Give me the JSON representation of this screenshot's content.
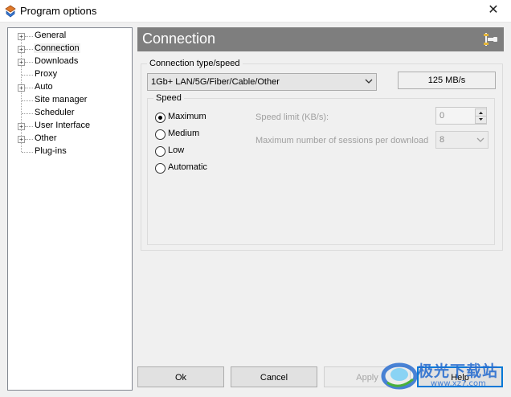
{
  "window": {
    "title": "Program options",
    "close_glyph": "✕"
  },
  "tree": {
    "items": [
      {
        "label": "General",
        "expandable": true
      },
      {
        "label": "Connection",
        "expandable": true,
        "selected": true
      },
      {
        "label": "Downloads",
        "expandable": true
      },
      {
        "label": "Proxy",
        "expandable": false
      },
      {
        "label": "Auto",
        "expandable": true
      },
      {
        "label": "Site manager",
        "expandable": false
      },
      {
        "label": "Scheduler",
        "expandable": false
      },
      {
        "label": "User Interface",
        "expandable": true
      },
      {
        "label": "Other",
        "expandable": true
      },
      {
        "label": "Plug-ins",
        "expandable": false
      }
    ],
    "expand_glyph": "+"
  },
  "header": {
    "title": "Connection",
    "icon": "plug-icon"
  },
  "connection": {
    "group_label": "Connection type/speed",
    "type_value": "1Gb+  LAN/5G/Fiber/Cable/Other",
    "speed_readout": "125 MB/s"
  },
  "speed": {
    "group_label": "Speed",
    "options": [
      {
        "label": "Maximum",
        "checked": true
      },
      {
        "label": "Medium",
        "checked": false
      },
      {
        "label": "Low",
        "checked": false
      },
      {
        "label": "Automatic",
        "checked": false
      }
    ],
    "limit_label": "Speed limit (KB/s):",
    "limit_value": "0",
    "sessions_label": "Maximum number of sessions per download",
    "sessions_value": "8"
  },
  "buttons": {
    "ok": "Ok",
    "cancel": "Cancel",
    "apply": "Apply",
    "help": "Help"
  },
  "watermark": {
    "text": "极光下载站",
    "url": "www.xz7.com"
  },
  "colors": {
    "header_bg": "#7e7e7e",
    "focus_blue": "#0078d7",
    "watermark_blue": "#2c6fd0"
  }
}
